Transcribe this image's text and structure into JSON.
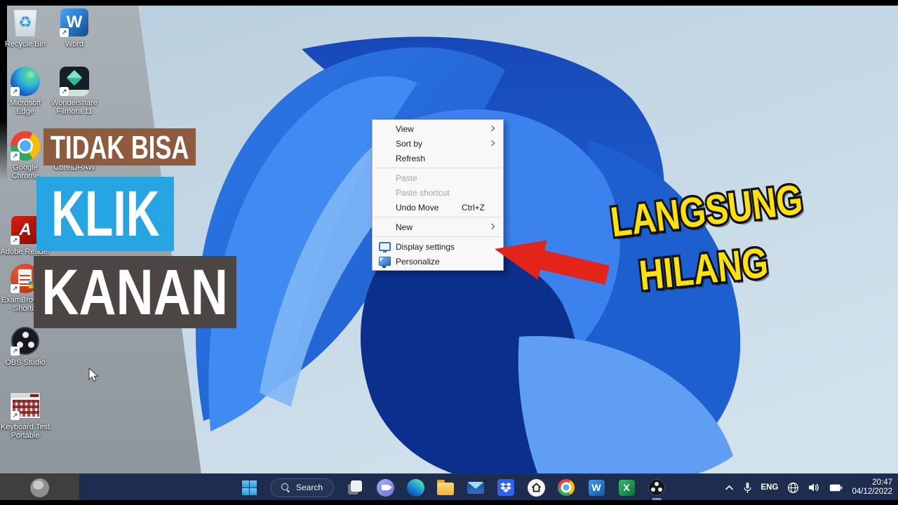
{
  "overlay": {
    "banners": [
      {
        "text": "TIDAK BISA",
        "bg": "#8e5b3f"
      },
      {
        "text": "KLIK",
        "bg": "#27a5e2"
      },
      {
        "text": "KANAN",
        "bg": "#4b4544"
      }
    ],
    "callout": {
      "line1": "LANGSUNG",
      "line2": "HILANG",
      "text_color": "#ffe10a",
      "arrow_color": "#e3241b"
    }
  },
  "desktop": {
    "shortcut_badge": "↗",
    "icons": [
      {
        "label": "Recycle Bin",
        "icon": "recycle-bin-icon",
        "glyph": "♻"
      },
      {
        "label": "Word",
        "icon": "word-icon",
        "glyph": "W"
      },
      {
        "label": "Microsoft Edge",
        "icon": "edge-icon"
      },
      {
        "label": "Wondershare Filmora 11",
        "icon": "filmora-icon"
      },
      {
        "label": "Google Chrome",
        "icon": "chrome-icon"
      },
      {
        "label": "CorelDRAW",
        "icon": "coreldraw-icon"
      },
      {
        "label": "Adobe Reader",
        "icon": "adobe-reader-icon",
        "glyph": "A"
      },
      {
        "label": "ExamBrowser - Shortcut",
        "icon": "exambrowser-icon"
      },
      {
        "label": "OBS Studio",
        "icon": "obs-studio-icon"
      },
      {
        "label": "Keyboard Test Portable",
        "icon": "keyboard-test-icon"
      }
    ]
  },
  "context_menu": {
    "items": [
      {
        "label": "View",
        "submenu": true
      },
      {
        "label": "Sort by",
        "submenu": true
      },
      {
        "label": "Refresh"
      },
      {
        "label": "Paste",
        "disabled": true
      },
      {
        "label": "Paste shortcut",
        "disabled": true
      },
      {
        "label": "Undo Move",
        "shortcut": "Ctrl+Z"
      },
      {
        "label": "New",
        "submenu": true
      },
      {
        "label": "Display settings",
        "icon": "display-settings-icon"
      },
      {
        "label": "Personalize",
        "icon": "personalize-icon"
      }
    ]
  },
  "taskbar": {
    "search_label": "Search",
    "icons": [
      {
        "name": "start"
      },
      {
        "name": "task-view"
      },
      {
        "name": "chat"
      },
      {
        "name": "edge"
      },
      {
        "name": "file-explorer"
      },
      {
        "name": "mail"
      },
      {
        "name": "dropbox"
      },
      {
        "name": "home-app"
      },
      {
        "name": "chrome"
      },
      {
        "name": "word",
        "glyph": "W"
      },
      {
        "name": "excel",
        "glyph": "X"
      },
      {
        "name": "obs-studio",
        "running": true
      }
    ],
    "tray": {
      "language": "ENG",
      "time": "20:47",
      "date": "04/12/2022"
    }
  },
  "colors": {
    "taskbar_bg": "#1e2c4e",
    "menu_bg": "#f8f8f8",
    "wallpaper_blue": "#2e78e8",
    "wallpaper_navy": "#0b2f8c",
    "sky": "#c6d9e6",
    "left_shade": "#99a1a8"
  }
}
